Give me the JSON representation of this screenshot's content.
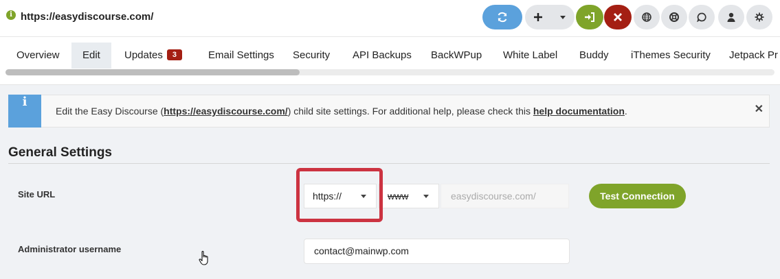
{
  "header": {
    "site_url": "https://easydiscourse.com/",
    "info_icon": "info-icon",
    "buttons": [
      {
        "name": "sync-icon",
        "color": "#5ba1dc"
      },
      {
        "name": "add-icon"
      },
      {
        "name": "login-icon",
        "color": "#7fa42a"
      },
      {
        "name": "close-icon",
        "color": "#a41f13"
      },
      {
        "name": "globe-icon"
      },
      {
        "name": "help-icon"
      },
      {
        "name": "chat-icon"
      },
      {
        "name": "user-icon"
      },
      {
        "name": "gear-icon"
      }
    ]
  },
  "tabs": {
    "items": [
      "Overview",
      "Edit",
      "Updates",
      "Email Settings",
      "Security",
      "API Backups",
      "BackWPup",
      "White Label",
      "Buddy",
      "iThemes Security",
      "Jetpack Pr"
    ],
    "active": "Edit",
    "updates_badge": "3"
  },
  "message": {
    "prefix": "Edit the Easy Discourse (",
    "link": "https://easydiscourse.com/",
    "middle": ") child site settings. For additional help, please check this ",
    "help_link": "help documentation",
    "suffix": "."
  },
  "settings": {
    "title": "General Settings",
    "site_url_label": "Site URL",
    "protocol": "https://",
    "www": "www",
    "domain_placeholder": "easydiscourse.com/",
    "test_button": "Test Connection",
    "admin_label": "Administrator username",
    "admin_value": "contact@mainwp.com"
  },
  "colors": {
    "accent_blue": "#5ba1dc",
    "accent_green": "#7fa42a",
    "accent_red": "#a41f13",
    "highlight": "#cc3341"
  }
}
